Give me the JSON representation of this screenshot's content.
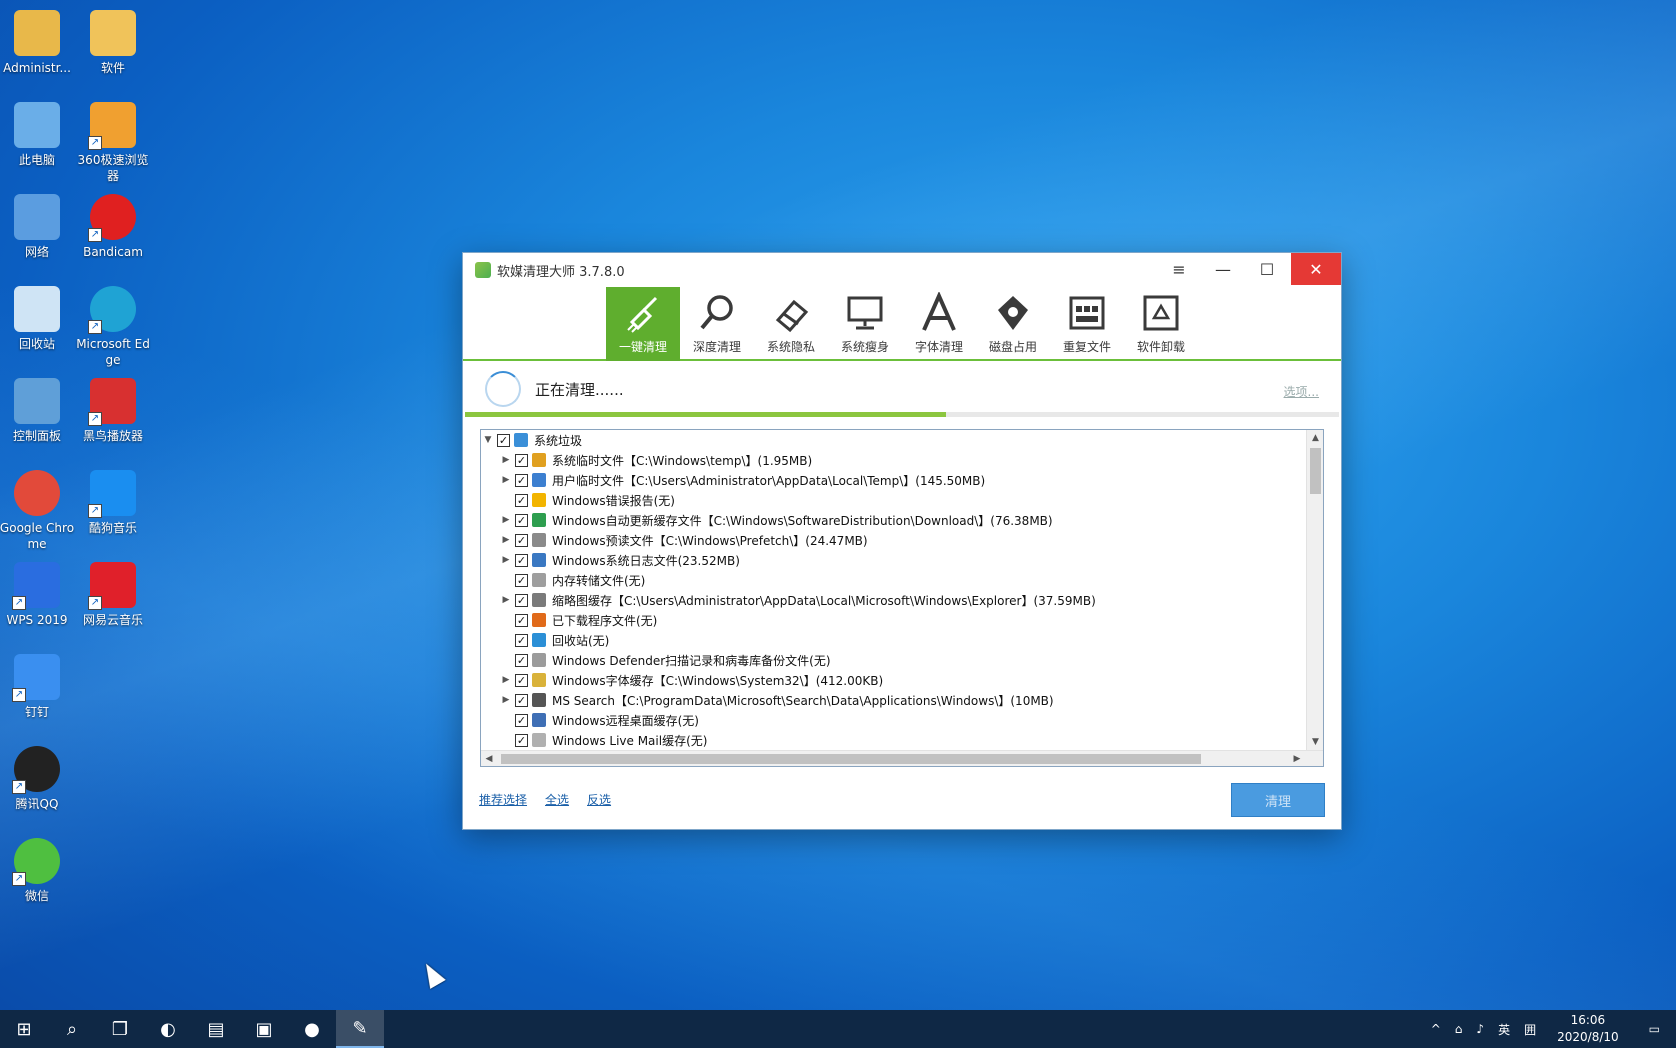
{
  "desktop": {
    "icons": [
      {
        "label": "Administr...",
        "icon": "user-folder-icon",
        "shortcut": false
      },
      {
        "label": "软件",
        "icon": "folder-icon",
        "shortcut": false
      },
      {
        "label": "此电脑",
        "icon": "computer-icon",
        "shortcut": false
      },
      {
        "label": "360极速浏览器",
        "icon": "browser-360-icon",
        "shortcut": true
      },
      {
        "label": "网络",
        "icon": "network-icon",
        "shortcut": false
      },
      {
        "label": "Bandicam",
        "icon": "record-icon",
        "shortcut": true
      },
      {
        "label": "回收站",
        "icon": "recycle-bin-icon",
        "shortcut": false
      },
      {
        "label": "Microsoft Edge",
        "icon": "edge-icon",
        "shortcut": true
      },
      {
        "label": "控制面板",
        "icon": "control-panel-icon",
        "shortcut": false
      },
      {
        "label": "黑鸟播放器",
        "icon": "player-icon",
        "shortcut": true
      },
      {
        "label": "Google Chrome",
        "icon": "chrome-icon",
        "shortcut": false
      },
      {
        "label": "酷狗音乐",
        "icon": "kugou-icon",
        "shortcut": true
      },
      {
        "label": "WPS 2019",
        "icon": "wps-icon",
        "shortcut": true
      },
      {
        "label": "网易云音乐",
        "icon": "netease-music-icon",
        "shortcut": true
      },
      {
        "label": "钉钉",
        "icon": "dingtalk-icon",
        "shortcut": true
      },
      {
        "label": "腾讯QQ",
        "icon": "qq-icon",
        "shortcut": true
      },
      {
        "label": "微信",
        "icon": "wechat-icon",
        "shortcut": true
      }
    ]
  },
  "window": {
    "title": "软媒清理大师 3.7.8.0",
    "controls": {
      "menu": "≡",
      "minimize": "—",
      "maximize": "☐",
      "close": "✕"
    }
  },
  "toolbar": {
    "tools": [
      {
        "label": "一键清理",
        "icon": "broom-icon",
        "active": true
      },
      {
        "label": "深度清理",
        "icon": "magnifier-icon",
        "active": false
      },
      {
        "label": "系统隐私",
        "icon": "eraser-icon",
        "active": false
      },
      {
        "label": "系统瘦身",
        "icon": "monitor-icon",
        "active": false
      },
      {
        "label": "字体清理",
        "icon": "font-icon",
        "active": false
      },
      {
        "label": "磁盘占用",
        "icon": "disk-icon",
        "active": false
      },
      {
        "label": "重复文件",
        "icon": "duplicate-icon",
        "active": false
      },
      {
        "label": "软件卸载",
        "icon": "uninstall-icon",
        "active": false
      }
    ]
  },
  "status": {
    "text": "正在清理......",
    "options_link": "选项...",
    "progress": 0.55
  },
  "tree": {
    "root": {
      "label": "系统垃圾",
      "expanded": true,
      "checked": true
    },
    "items": [
      {
        "label": "系统临时文件【C:\\Windows\\temp\\】(1.95MB)",
        "expandable": true,
        "color": "#e0a020"
      },
      {
        "label": "用户临时文件【C:\\Users\\Administrator\\AppData\\Local\\Temp\\】(145.50MB)",
        "expandable": true,
        "color": "#3c7fd0"
      },
      {
        "label": "Windows错误报告(无)",
        "expandable": false,
        "color": "#f2b400"
      },
      {
        "label": "Windows自动更新缓存文件【C:\\Windows\\SoftwareDistribution\\Download\\】(76.38MB)",
        "expandable": true,
        "color": "#2e9e4f"
      },
      {
        "label": "Windows预读文件【C:\\Windows\\Prefetch\\】(24.47MB)",
        "expandable": true,
        "color": "#8a8a8a"
      },
      {
        "label": "Windows系统日志文件(23.52MB)",
        "expandable": true,
        "color": "#3a78c2"
      },
      {
        "label": "内存转储文件(无)",
        "expandable": false,
        "color": "#9e9e9e"
      },
      {
        "label": "缩略图缓存【C:\\Users\\Administrator\\AppData\\Local\\Microsoft\\Windows\\Explorer】(37.59MB)",
        "expandable": true,
        "color": "#7a7a7a"
      },
      {
        "label": "已下载程序文件(无)",
        "expandable": false,
        "color": "#e06a1a"
      },
      {
        "label": "回收站(无)",
        "expandable": false,
        "color": "#2b8fd6"
      },
      {
        "label": "Windows Defender扫描记录和病毒库备份文件(无)",
        "expandable": false,
        "color": "#9b9b9b"
      },
      {
        "label": "Windows字体缓存【C:\\Windows\\System32\\】(412.00KB)",
        "expandable": true,
        "color": "#d9b23a"
      },
      {
        "label": "MS Search【C:\\ProgramData\\Microsoft\\Search\\Data\\Applications\\Windows\\】(10MB)",
        "expandable": true,
        "color": "#555555"
      },
      {
        "label": "Windows远程桌面缓存(无)",
        "expandable": false,
        "color": "#3f6fb5"
      },
      {
        "label": "Windows Live Mail缓存(无)",
        "expandable": false,
        "color": "#b0b0b0"
      }
    ]
  },
  "footer": {
    "recommend": "推荐选择",
    "select_all": "全选",
    "invert": "反选",
    "clean_button": "清理"
  },
  "taskbar": {
    "items": [
      {
        "icon": "windows-start-icon",
        "glyph": "⊞",
        "active": false
      },
      {
        "icon": "search-icon",
        "glyph": "⌕",
        "active": false
      },
      {
        "icon": "task-view-icon",
        "glyph": "❐",
        "active": false
      },
      {
        "icon": "edge-icon",
        "glyph": "◐",
        "active": false
      },
      {
        "icon": "file-explorer-icon",
        "glyph": "▤",
        "active": false
      },
      {
        "icon": "store-icon",
        "glyph": "▣",
        "active": false
      },
      {
        "icon": "bandicam-icon",
        "glyph": "●",
        "active": false
      },
      {
        "icon": "cleaner-app-icon",
        "glyph": "✎",
        "active": true
      }
    ],
    "tray": {
      "chevron": "^",
      "network": "⌂",
      "volume": "♪",
      "ime": "英",
      "ime2": "囲",
      "time": "16:06",
      "date": "2020/8/10",
      "notification": "▭"
    }
  }
}
